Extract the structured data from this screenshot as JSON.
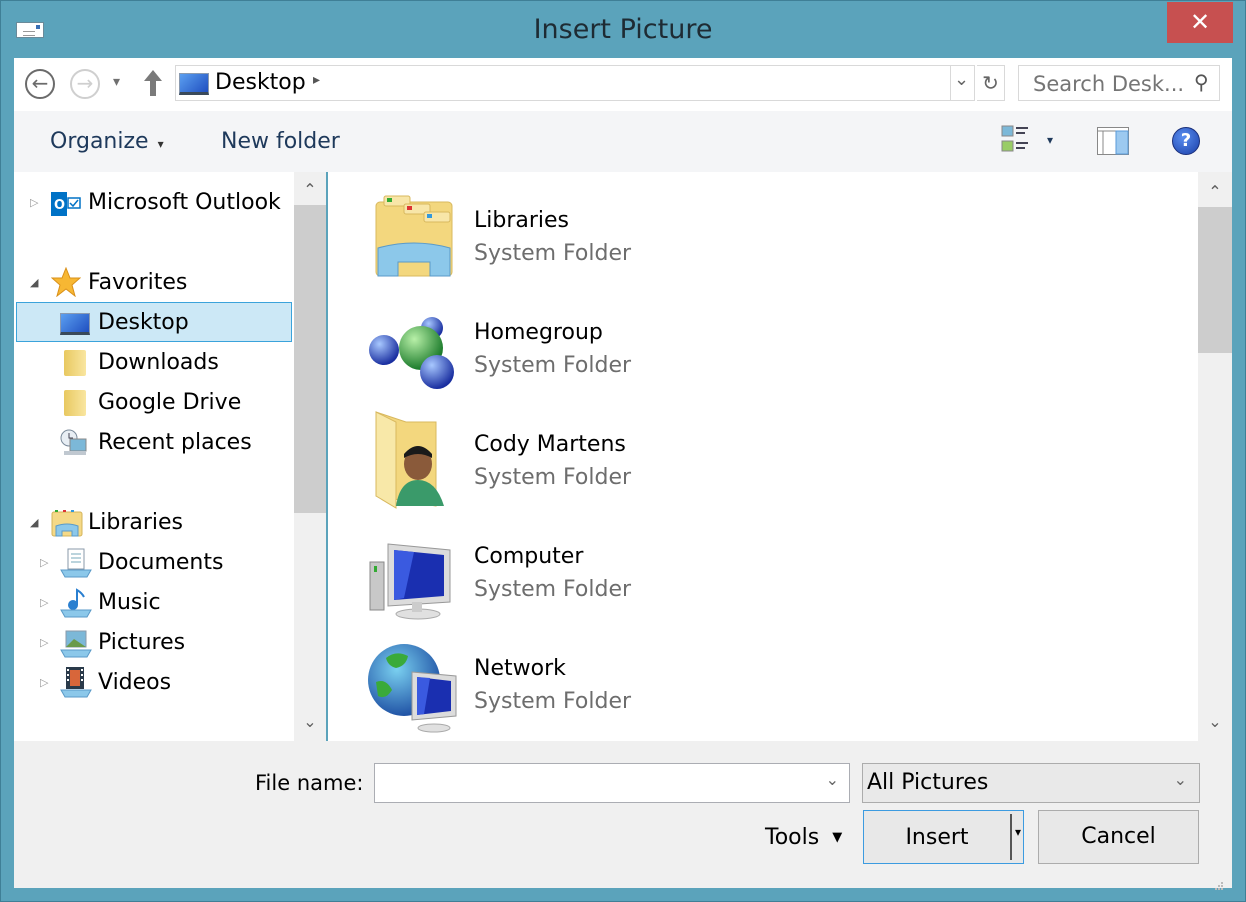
{
  "window": {
    "title": "Insert Picture",
    "close_label": "✕"
  },
  "nav": {
    "back_glyph": "←",
    "forward_glyph": "→",
    "recent_glyph": "▾",
    "up_glyph": "🡑",
    "address": "Desktop",
    "address_chevron": "▸",
    "address_dropdown": "⌄",
    "refresh_glyph": "↻",
    "search_placeholder": "Search Desk...",
    "search_glyph": "⚲"
  },
  "toolbar": {
    "organize_label": "Organize",
    "organize_caret": "▾",
    "new_folder_label": "New folder",
    "view_caret": "▾",
    "help_glyph": "?"
  },
  "navpane": {
    "scroll_up": "⌃",
    "scroll_down": "⌄",
    "items": [
      {
        "label": "Microsoft Outlook",
        "icon": "outlook-icon",
        "expander": "▷"
      },
      {
        "label": "Favorites",
        "icon": "star-icon",
        "expander": "◢"
      },
      {
        "label": "Desktop",
        "icon": "desktop-icon",
        "selected": true
      },
      {
        "label": "Downloads",
        "icon": "folder-icon"
      },
      {
        "label": "Google Drive",
        "icon": "folder-icon"
      },
      {
        "label": "Recent places",
        "icon": "recent-places-icon"
      },
      {
        "label": "Libraries",
        "icon": "libraries-icon",
        "expander": "◢"
      },
      {
        "label": "Documents",
        "icon": "documents-icon",
        "expander": "▷"
      },
      {
        "label": "Music",
        "icon": "music-icon",
        "expander": "▷"
      },
      {
        "label": "Pictures",
        "icon": "pictures-icon",
        "expander": "▷"
      },
      {
        "label": "Videos",
        "icon": "videos-icon",
        "expander": "▷"
      }
    ]
  },
  "content": {
    "scroll_up": "⌃",
    "scroll_down": "⌄",
    "items": [
      {
        "name": "Libraries",
        "type": "System Folder"
      },
      {
        "name": "Homegroup",
        "type": "System Folder"
      },
      {
        "name": "Cody Martens",
        "type": "System Folder"
      },
      {
        "name": "Computer",
        "type": "System Folder"
      },
      {
        "name": "Network",
        "type": "System Folder"
      }
    ]
  },
  "footer": {
    "file_name_label": "File name:",
    "file_name_value": "",
    "file_name_dropdown": "⌄",
    "file_type_value": "All Pictures",
    "file_type_dropdown": "⌄",
    "tools_label": "Tools",
    "tools_caret": "▼",
    "insert_label": "Insert",
    "insert_caret": "▾",
    "cancel_label": "Cancel"
  },
  "colors": {
    "titlebar": "#5ba3bb",
    "close": "#c75050",
    "selection": "#cce8f6",
    "selection_border": "#3ba3db"
  }
}
